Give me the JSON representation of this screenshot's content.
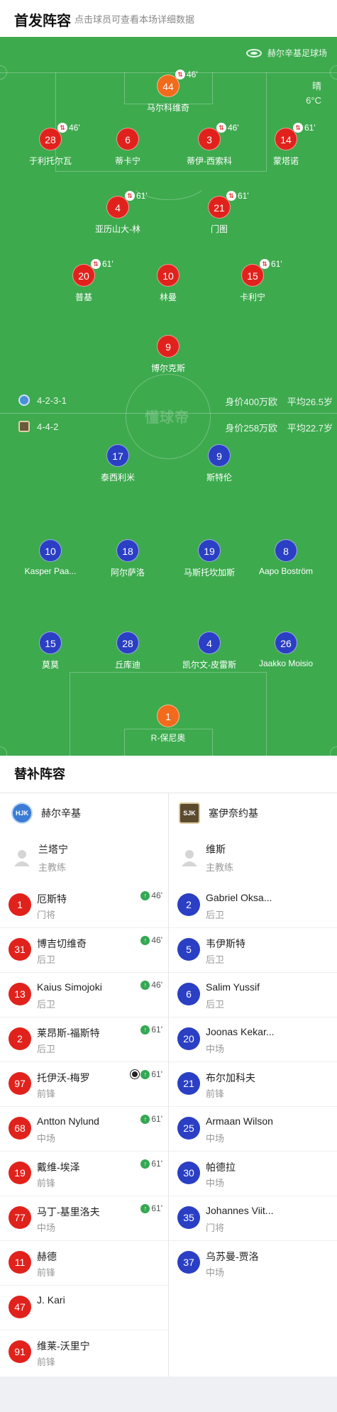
{
  "header": {
    "title": "首发阵容",
    "subtitle": "点击球员可查看本场详细数据"
  },
  "pitch": {
    "stadium": "赫尔辛基足球场",
    "weather": "晴",
    "temperature": "6°C",
    "watermark": "懂球帝",
    "colors": {
      "pitch": "#3daa4e",
      "home": "#e1221c",
      "away": "#2a3fc4",
      "keeper": "#f26a1b"
    }
  },
  "away_team": {
    "formation": "4-2-3-1",
    "value": "身价400万欧",
    "age": "平均26.5岁",
    "keeper": {
      "number": "44",
      "name": "马尔科维奇",
      "sub": "46'"
    },
    "defenders": [
      {
        "number": "28",
        "name": "于利托尔瓦",
        "sub": "46'"
      },
      {
        "number": "6",
        "name": "蒂卡宁",
        "sub": ""
      },
      {
        "number": "3",
        "name": "蒂伊-西索科",
        "sub": "46'"
      },
      {
        "number": "14",
        "name": "蒙塔诺",
        "sub": "61'"
      }
    ],
    "midfield_two": [
      {
        "number": "4",
        "name": "亚历山大-林",
        "sub": "61'"
      },
      {
        "number": "21",
        "name": "门图",
        "sub": "61'"
      }
    ],
    "midfield_three": [
      {
        "number": "20",
        "name": "普基",
        "sub": "61'"
      },
      {
        "number": "10",
        "name": "林曼",
        "sub": ""
      },
      {
        "number": "15",
        "name": "卡利宁",
        "sub": "61'"
      }
    ],
    "striker": {
      "number": "9",
      "name": "博尔克斯",
      "sub": ""
    }
  },
  "home_team": {
    "formation": "4-4-2",
    "value": "身价258万欧",
    "age": "平均22.7岁",
    "forwards": [
      {
        "number": "17",
        "name": "泰西利米"
      },
      {
        "number": "9",
        "name": "斯特伦"
      }
    ],
    "midfield": [
      {
        "number": "10",
        "name": "Kasper Paa..."
      },
      {
        "number": "18",
        "name": "阿尔萨洛"
      },
      {
        "number": "19",
        "name": "马斯托坎加斯"
      },
      {
        "number": "8",
        "name": "Aapo Boström"
      }
    ],
    "defenders": [
      {
        "number": "15",
        "name": "莫莫"
      },
      {
        "number": "28",
        "name": "丘库迪"
      },
      {
        "number": "4",
        "name": "凯尔文-皮雷斯"
      },
      {
        "number": "26",
        "name": "Jaakko Moisio"
      }
    ],
    "keeper": {
      "number": "1",
      "name": "R-保尼奥"
    }
  },
  "substitutes": {
    "title": "替补阵容",
    "left": {
      "team": "赫尔辛基",
      "coach": {
        "name": "兰塔宁",
        "role": "主教练"
      },
      "players": [
        {
          "number": "1",
          "name": "厄斯特",
          "role": "门将",
          "minute": "46'",
          "goal": false
        },
        {
          "number": "31",
          "name": "博吉切维奇",
          "role": "后卫",
          "minute": "46'",
          "goal": false
        },
        {
          "number": "13",
          "name": "Kaius Simojoki",
          "role": "后卫",
          "minute": "46'",
          "goal": false
        },
        {
          "number": "2",
          "name": "莱昂斯-福斯特",
          "role": "后卫",
          "minute": "61'",
          "goal": false
        },
        {
          "number": "97",
          "name": "托伊沃-梅罗",
          "role": "前锋",
          "minute": "61'",
          "goal": true
        },
        {
          "number": "68",
          "name": "Antton Nylund",
          "role": "中场",
          "minute": "61'",
          "goal": false
        },
        {
          "number": "19",
          "name": "戴维-埃泽",
          "role": "前锋",
          "minute": "61'",
          "goal": false
        },
        {
          "number": "77",
          "name": "马丁-基里洛夫",
          "role": "中场",
          "minute": "61'",
          "goal": false
        },
        {
          "number": "11",
          "name": "赫德",
          "role": "前锋",
          "minute": "",
          "goal": false
        },
        {
          "number": "47",
          "name": "J. Kari",
          "role": "",
          "minute": "",
          "goal": false
        },
        {
          "number": "91",
          "name": "维莱-沃里宁",
          "role": "前锋",
          "minute": "",
          "goal": false
        }
      ]
    },
    "right": {
      "team": "塞伊奈约基",
      "coach": {
        "name": "维斯",
        "role": "主教练"
      },
      "players": [
        {
          "number": "2",
          "name": "Gabriel Oksa...",
          "role": "后卫"
        },
        {
          "number": "5",
          "name": "韦伊斯特",
          "role": "后卫"
        },
        {
          "number": "6",
          "name": "Salim Yussif",
          "role": "后卫"
        },
        {
          "number": "20",
          "name": "Joonas Kekar...",
          "role": "中场"
        },
        {
          "number": "21",
          "name": "布尔加科夫",
          "role": "前锋"
        },
        {
          "number": "25",
          "name": "Armaan Wilson",
          "role": "中场"
        },
        {
          "number": "30",
          "name": "帕德拉",
          "role": "中场"
        },
        {
          "number": "35",
          "name": "Johannes Viit...",
          "role": "门将"
        },
        {
          "number": "37",
          "name": "乌苏曼-贾洛",
          "role": "中场"
        }
      ]
    }
  }
}
